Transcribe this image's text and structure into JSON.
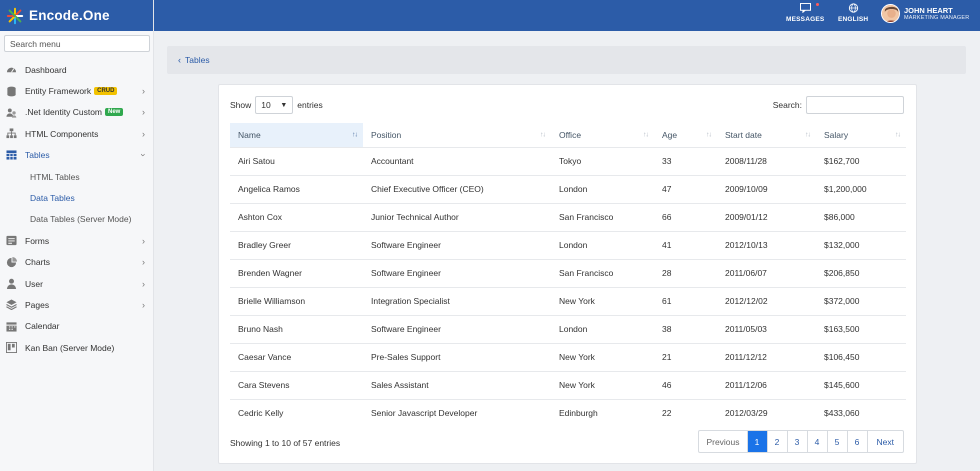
{
  "brand": {
    "name": "Encode.One"
  },
  "sidebar": {
    "search_placeholder": "Search menu",
    "items": [
      {
        "label": "Dashboard",
        "icon": "dashboard-icon"
      },
      {
        "label": "Entity Framework",
        "icon": "database-icon",
        "badge": "CRUD"
      },
      {
        "label": ".Net Identity Custom",
        "icon": "users-icon",
        "badge": "New"
      },
      {
        "label": "HTML Components",
        "icon": "sitemap-icon"
      },
      {
        "label": "Tables",
        "icon": "table-icon"
      },
      {
        "label": "Forms",
        "icon": "form-icon"
      },
      {
        "label": "Charts",
        "icon": "pie-chart-icon"
      },
      {
        "label": "User",
        "icon": "user-icon"
      },
      {
        "label": "Pages",
        "icon": "layers-icon"
      },
      {
        "label": "Calendar",
        "icon": "calendar-icon"
      },
      {
        "label": "Kan Ban (Server Mode)",
        "icon": "kanban-icon"
      }
    ],
    "tables_sub": [
      "HTML Tables",
      "Data Tables",
      "Data Tables (Server Mode)"
    ]
  },
  "topbar": {
    "messages": "MESSAGES",
    "language": "ENGLISH",
    "user_name": "JOHN HEART",
    "user_role": "MARKETING MANAGER"
  },
  "breadcrumb": {
    "label": "Tables"
  },
  "table": {
    "length_prefix": "Show",
    "length_value": "10",
    "length_suffix": "entries",
    "search_label": "Search:",
    "headers": [
      "Name",
      "Position",
      "Office",
      "Age",
      "Start date",
      "Salary"
    ],
    "rows": [
      [
        "Airi Satou",
        "Accountant",
        "Tokyo",
        "33",
        "2008/11/28",
        "$162,700"
      ],
      [
        "Angelica Ramos",
        "Chief Executive Officer (CEO)",
        "London",
        "47",
        "2009/10/09",
        "$1,200,000"
      ],
      [
        "Ashton Cox",
        "Junior Technical Author",
        "San Francisco",
        "66",
        "2009/01/12",
        "$86,000"
      ],
      [
        "Bradley Greer",
        "Software Engineer",
        "London",
        "41",
        "2012/10/13",
        "$132,000"
      ],
      [
        "Brenden Wagner",
        "Software Engineer",
        "San Francisco",
        "28",
        "2011/06/07",
        "$206,850"
      ],
      [
        "Brielle Williamson",
        "Integration Specialist",
        "New York",
        "61",
        "2012/12/02",
        "$372,000"
      ],
      [
        "Bruno Nash",
        "Software Engineer",
        "London",
        "38",
        "2011/05/03",
        "$163,500"
      ],
      [
        "Caesar Vance",
        "Pre-Sales Support",
        "New York",
        "21",
        "2011/12/12",
        "$106,450"
      ],
      [
        "Cara Stevens",
        "Sales Assistant",
        "New York",
        "46",
        "2011/12/06",
        "$145,600"
      ],
      [
        "Cedric Kelly",
        "Senior Javascript Developer",
        "Edinburgh",
        "22",
        "2012/03/29",
        "$433,060"
      ]
    ],
    "info": "Showing 1 to 10 of 57 entries",
    "pagination": {
      "previous": "Previous",
      "pages": [
        "1",
        "2",
        "3",
        "4",
        "5",
        "6"
      ],
      "next": "Next"
    }
  },
  "colors": {
    "brand": "#2c5ca8",
    "active_page": "#1a73e8",
    "crud_badge": "#f2c200",
    "new_badge": "#30a84e"
  }
}
